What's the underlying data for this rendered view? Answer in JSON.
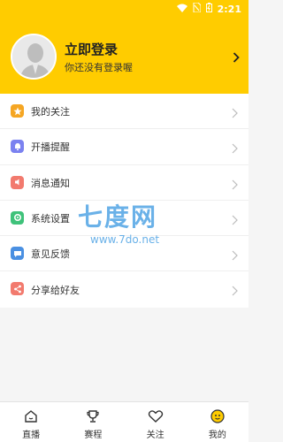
{
  "status_bar": {
    "time": "2:21"
  },
  "header": {
    "login_title": "立即登录",
    "login_subtitle": "你还没有登录喔"
  },
  "menu": {
    "items": [
      {
        "label": "我的关注",
        "icon": "star-icon",
        "color": "#f5a623"
      },
      {
        "label": "开播提醒",
        "icon": "bell-icon",
        "color": "#7b82f0"
      },
      {
        "label": "消息通知",
        "icon": "speaker-icon",
        "color": "#f27a6e"
      },
      {
        "label": "系统设置",
        "icon": "gear-icon",
        "color": "#3fc27a"
      },
      {
        "label": "意见反馈",
        "icon": "chat-bubble-icon",
        "color": "#4a90e2"
      },
      {
        "label": "分享给好友",
        "icon": "share-icon",
        "color": "#f27a6e"
      }
    ]
  },
  "watermark": {
    "main": "七度网",
    "url": "www.7do.net"
  },
  "tabbar": {
    "tabs": [
      {
        "label": "直播",
        "icon": "home-icon"
      },
      {
        "label": "赛程",
        "icon": "trophy-icon"
      },
      {
        "label": "关注",
        "icon": "heart-icon"
      },
      {
        "label": "我的",
        "icon": "profile-icon"
      }
    ]
  },
  "colors": {
    "accent": "#ffcc00"
  }
}
